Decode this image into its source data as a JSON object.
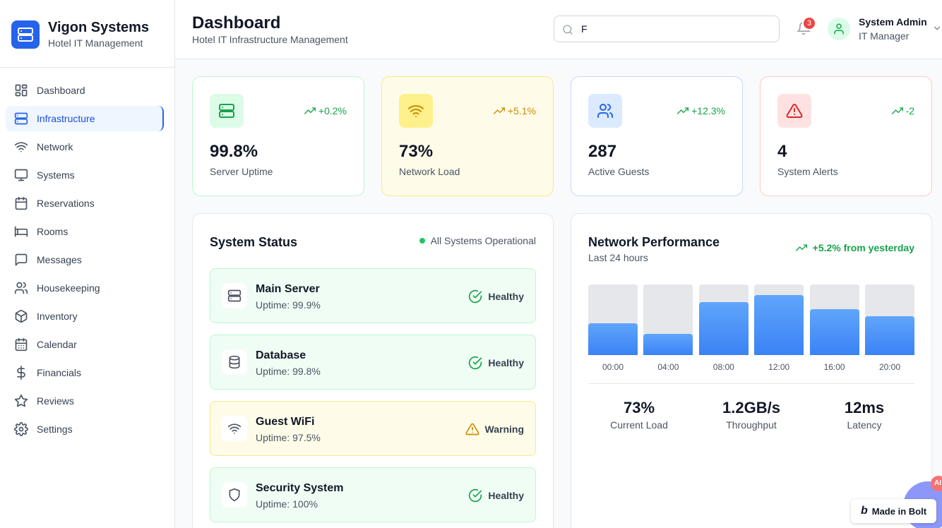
{
  "brand": {
    "name": "Vigon Systems",
    "subtitle": "Hotel IT Management"
  },
  "sidebar": {
    "items": [
      {
        "label": "Dashboard",
        "icon": "dashboard-icon"
      },
      {
        "label": "Infrastructure",
        "icon": "server-icon",
        "active": true
      },
      {
        "label": "Network",
        "icon": "wifi-icon"
      },
      {
        "label": "Systems",
        "icon": "monitor-icon"
      },
      {
        "label": "Reservations",
        "icon": "calendar-icon"
      },
      {
        "label": "Rooms",
        "icon": "bed-icon"
      },
      {
        "label": "Messages",
        "icon": "message-icon"
      },
      {
        "label": "Housekeeping",
        "icon": "users-icon"
      },
      {
        "label": "Inventory",
        "icon": "box-icon"
      },
      {
        "label": "Calendar",
        "icon": "calendar-days-icon"
      },
      {
        "label": "Financials",
        "icon": "dollar-icon"
      },
      {
        "label": "Reviews",
        "icon": "star-icon"
      },
      {
        "label": "Settings",
        "icon": "gear-icon"
      }
    ]
  },
  "header": {
    "title": "Dashboard",
    "subtitle": "Hotel IT Infrastructure Management",
    "search_value": "F",
    "notification_count": "3"
  },
  "user": {
    "name": "System Admin",
    "role": "IT Manager"
  },
  "stats": [
    {
      "value": "99.8%",
      "label": "Server Uptime",
      "trend": "+0.2%",
      "icon": "server-icon",
      "accent": "#16a34a"
    },
    {
      "value": "73%",
      "label": "Network Load",
      "trend": "+5.1%",
      "icon": "wifi-icon",
      "accent": "#ca8a04"
    },
    {
      "value": "287",
      "label": "Active Guests",
      "trend": "+12.3%",
      "icon": "users-icon",
      "accent": "#2563eb"
    },
    {
      "value": "4",
      "label": "System Alerts",
      "trend": "-2",
      "icon": "alert-triangle-icon",
      "accent": "#dc2626"
    }
  ],
  "system_status": {
    "title": "System Status",
    "overall": "All Systems Operational",
    "items": [
      {
        "name": "Main Server",
        "uptime": "Uptime: 99.9%",
        "status": "Healthy",
        "icon": "server-icon"
      },
      {
        "name": "Database",
        "uptime": "Uptime: 99.8%",
        "status": "Healthy",
        "icon": "database-icon"
      },
      {
        "name": "Guest WiFi",
        "uptime": "Uptime: 97.5%",
        "status": "Warning",
        "icon": "wifi-icon"
      },
      {
        "name": "Security System",
        "uptime": "Uptime: 100%",
        "status": "Healthy",
        "icon": "shield-icon"
      }
    ]
  },
  "network_performance": {
    "title": "Network Performance",
    "subtitle": "Last 24 hours",
    "trend": "+5.2% from yesterday",
    "metrics": [
      {
        "value": "73%",
        "label": "Current Load"
      },
      {
        "value": "1.2GB/s",
        "label": "Throughput"
      },
      {
        "value": "12ms",
        "label": "Latency"
      }
    ]
  },
  "chart_data": {
    "type": "bar",
    "categories": [
      "00:00",
      "04:00",
      "08:00",
      "12:00",
      "16:00",
      "20:00"
    ],
    "values": [
      45,
      30,
      75,
      85,
      65,
      55
    ],
    "ylim": [
      0,
      100
    ]
  },
  "badge": {
    "label": "Made in Bolt",
    "fab_text": "AI"
  }
}
